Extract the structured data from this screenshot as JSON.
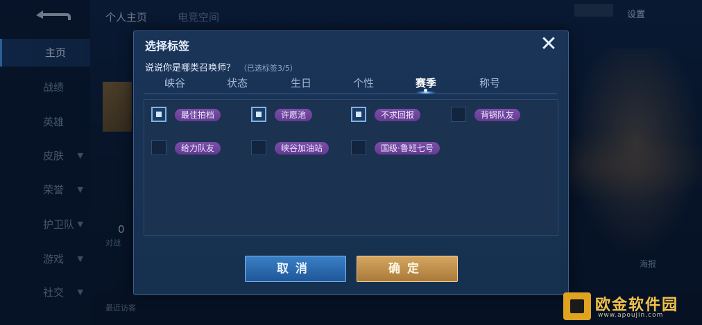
{
  "background": {
    "top_tabs": [
      "个人主页",
      "电竞空间"
    ],
    "settings_label": "设置",
    "left_nav": [
      {
        "label": "主页",
        "has_chevron": false,
        "active": true
      },
      {
        "label": "战绩",
        "has_chevron": false,
        "active": false
      },
      {
        "label": "英雄",
        "has_chevron": false,
        "active": false
      },
      {
        "label": "皮肤",
        "has_chevron": true,
        "active": false
      },
      {
        "label": "荣誉",
        "has_chevron": true,
        "active": false
      },
      {
        "label": "护卫队",
        "has_chevron": true,
        "active": false
      },
      {
        "label": "游戏",
        "has_chevron": true,
        "active": false
      },
      {
        "label": "社交",
        "has_chevron": true,
        "active": false
      }
    ],
    "stat_value": "0",
    "stat_label": "对战",
    "recent_visitors": "最近访客",
    "poster_label": "海报"
  },
  "modal": {
    "title": "选择标签",
    "question": "说说你是哪类召唤师？",
    "selected_count": "（已选标签3/5）",
    "close_icon": "close-icon",
    "tabs": [
      {
        "label": "峡谷",
        "active": false
      },
      {
        "label": "状态",
        "active": false
      },
      {
        "label": "生日",
        "active": false
      },
      {
        "label": "个性",
        "active": false
      },
      {
        "label": "赛季",
        "active": true
      },
      {
        "label": "称号",
        "active": false
      }
    ],
    "tags": [
      {
        "label": "最佳拍档",
        "checked": true
      },
      {
        "label": "许愿池",
        "checked": true
      },
      {
        "label": "不求回报",
        "checked": true
      },
      {
        "label": "背锅队友",
        "checked": false
      },
      {
        "label": "给力队友",
        "checked": false
      },
      {
        "label": "峡谷加油站",
        "checked": false
      },
      {
        "label": "国级·鲁班七号",
        "checked": false
      }
    ],
    "cancel_label": "取消",
    "confirm_label": "确定"
  },
  "watermark": {
    "name": "欧金软件园",
    "url": "www.apoujin.com"
  },
  "colors": {
    "accent_blue": "#3a7fc6",
    "confirm_gold": "#d4a760",
    "tag_purple": "#7a4fa8"
  }
}
